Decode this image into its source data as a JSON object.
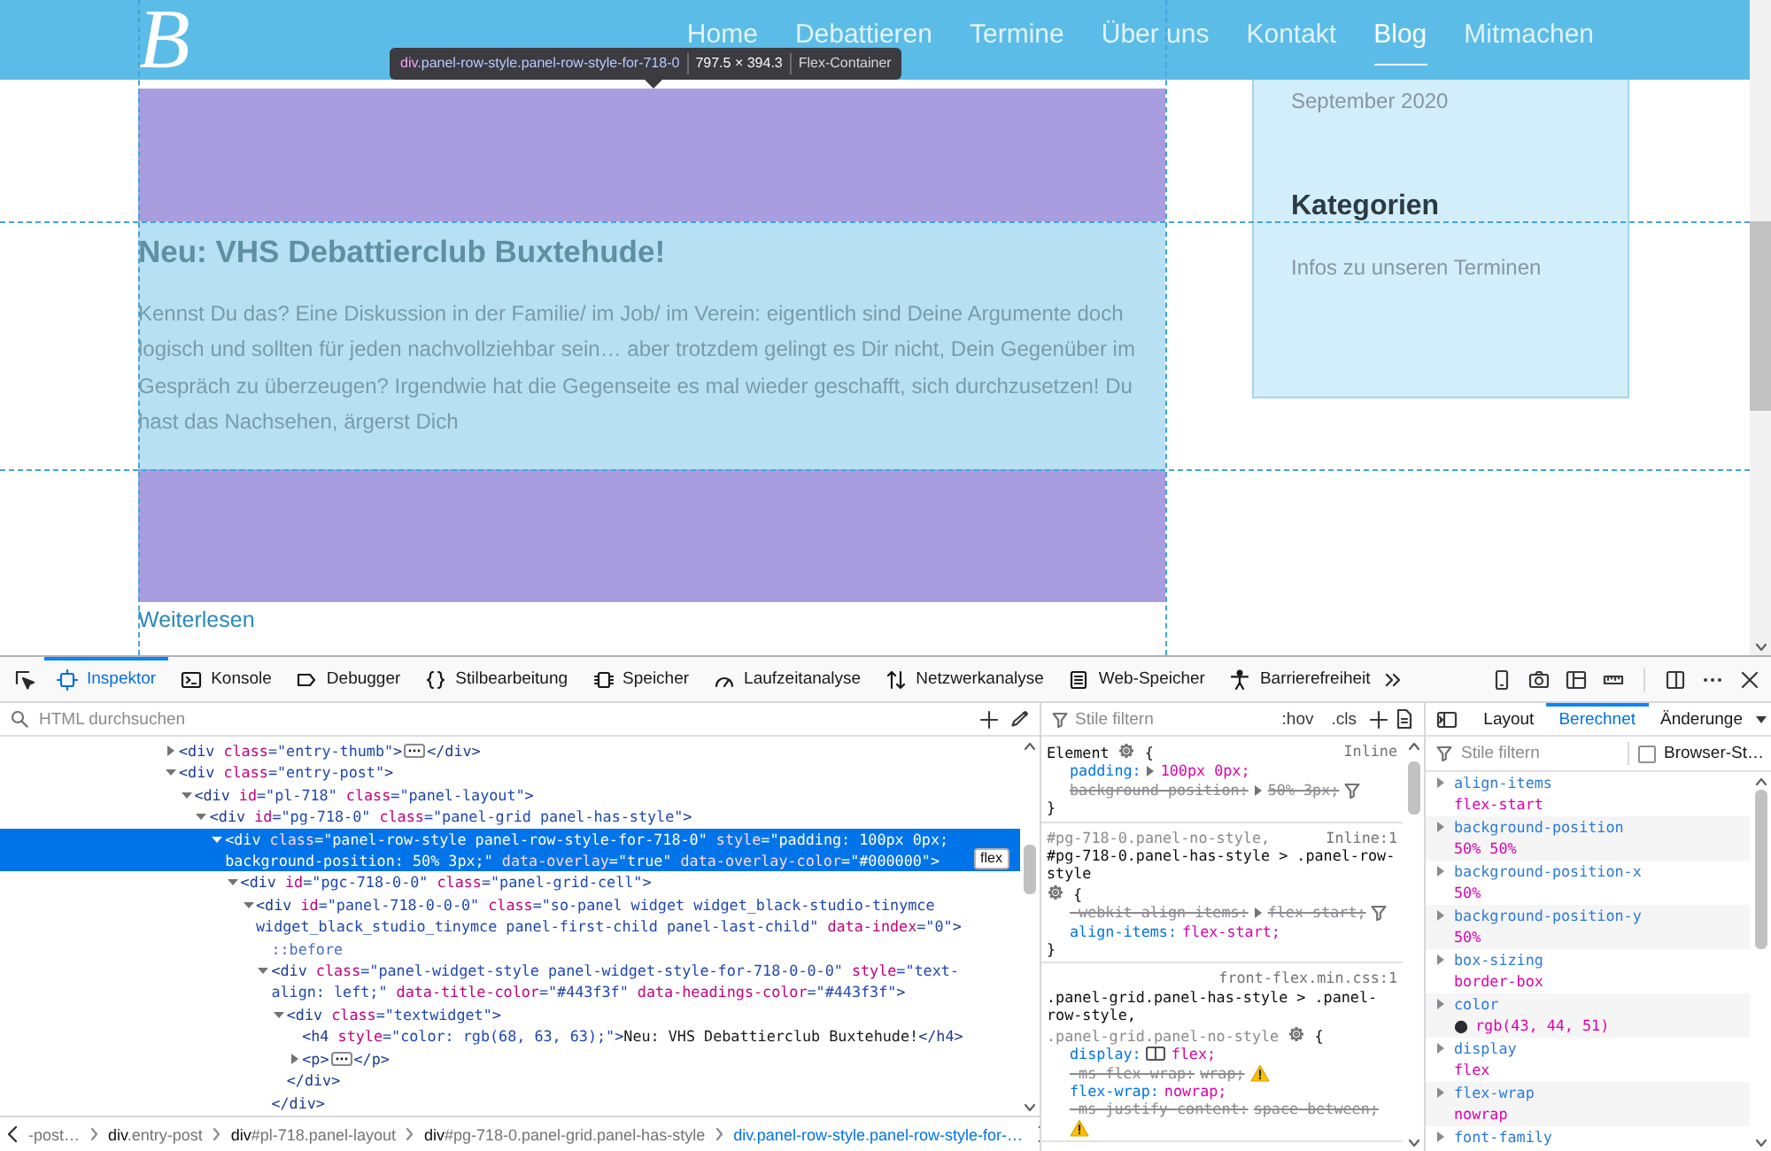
{
  "page": {
    "logo": "B",
    "nav": [
      {
        "label": "Home",
        "selected": false
      },
      {
        "label": "Debattieren",
        "selected": false
      },
      {
        "label": "Termine",
        "selected": false
      },
      {
        "label": "Über uns",
        "selected": false
      },
      {
        "label": "Kontakt",
        "selected": false
      },
      {
        "label": "Blog",
        "selected": true
      },
      {
        "label": "Mitmachen",
        "selected": false
      }
    ],
    "post": {
      "title": "Neu: VHS Debattierclub Buxtehude!",
      "excerpt": "Kennst Du das? Eine Diskussion in der Familie/ im Job/ im Verein: eigentlich sind Deine Argumente doch logisch und sollten für jeden nachvollziehbar sein… aber trotzdem gelingt es Dir nicht, Dein Gegenüber im Gespräch zu überzeugen? Irgendwie hat die Gegenseite es mal wieder geschafft, sich durchzusetzen! Du hast das Nachsehen, ärgerst Dich",
      "link": "Weiterlesen"
    },
    "sidebar": {
      "archive": [
        "September 2020"
      ],
      "categories_title": "Kategorien",
      "categories": [
        "Infos zu unseren Terminen"
      ]
    },
    "highlighter": {
      "tag": "div",
      "classes": ".panel-row-style.panel-row-style-for-718-0",
      "size": "797.5 × 394.3",
      "layout": "Flex-Container"
    }
  },
  "devtools": {
    "tabs": [
      {
        "label": "Inspektor",
        "selected": true
      },
      {
        "label": "Konsole",
        "selected": false
      },
      {
        "label": "Debugger",
        "selected": false
      },
      {
        "label": "Stilbearbeitung",
        "selected": false
      },
      {
        "label": "Speicher",
        "selected": false
      },
      {
        "label": "Laufzeitanalyse",
        "selected": false
      },
      {
        "label": "Netzwerkanalyse",
        "selected": false
      },
      {
        "label": "Web-Speicher",
        "selected": false
      },
      {
        "label": "Barrierefreiheit",
        "selected": false
      }
    ],
    "markup": {
      "search_placeholder": "HTML durchsuchen",
      "nodes": [
        {
          "open": [
            {
              "kind": "tag",
              "text": "<div"
            },
            {
              "kind": "attr",
              "text": " class"
            },
            {
              "kind": "value",
              "text": "=\"entry-thumb\""
            },
            {
              "kind": "tag",
              "text": ">"
            }
          ],
          "expanded": false,
          "selected": false,
          "close": [
            {
              "kind": "tag",
              "text": "</div>"
            }
          ]
        },
        {
          "open": [
            {
              "kind": "tag",
              "text": "<div"
            },
            {
              "kind": "attr",
              "text": " class"
            },
            {
              "kind": "value",
              "text": "=\"entry-post\""
            },
            {
              "kind": "tag",
              "text": ">"
            }
          ],
          "expanded": true,
          "selected": false,
          "children": [
            {
              "open": [
                {
                  "kind": "tag",
                  "text": "<div"
                },
                {
                  "kind": "attr",
                  "text": " id"
                },
                {
                  "kind": "value",
                  "text": "=\"pl-718\""
                },
                {
                  "kind": "attr",
                  "text": " class"
                },
                {
                  "kind": "value",
                  "text": "=\"panel-layout\""
                },
                {
                  "kind": "tag",
                  "text": ">"
                }
              ],
              "expanded": true,
              "selected": false,
              "children": [
                {
                  "open": [
                    {
                      "kind": "tag",
                      "text": "<div"
                    },
                    {
                      "kind": "attr",
                      "text": " id"
                    },
                    {
                      "kind": "value",
                      "text": "=\"pg-718-0\""
                    },
                    {
                      "kind": "attr",
                      "text": " class"
                    },
                    {
                      "kind": "value",
                      "text": "=\"panel-grid panel-has-style\""
                    },
                    {
                      "kind": "tag",
                      "text": ">"
                    }
                  ],
                  "expanded": true,
                  "selected": false,
                  "children": [
                    {
                      "open": [
                        {
                          "kind": "tag",
                          "text": "<div"
                        },
                        {
                          "kind": "attr",
                          "text": " class"
                        },
                        {
                          "kind": "value",
                          "text": "=\"panel-row-style panel-row-style-for-718-0\""
                        },
                        {
                          "kind": "attr",
                          "text": " style"
                        },
                        {
                          "kind": "value",
                          "text": "=\"padding: 100px 0px; background-position: 50% 3px;\""
                        },
                        {
                          "kind": "attr",
                          "text": " data-overlay"
                        },
                        {
                          "kind": "value",
                          "text": "=\"true\""
                        },
                        {
                          "kind": "attr",
                          "text": " data-overlay-color"
                        },
                        {
                          "kind": "value",
                          "text": "=\"#000000\""
                        },
                        {
                          "kind": "tag",
                          "text": ">"
                        }
                      ],
                      "expanded": true,
                      "selected": true,
                      "badge": "flex",
                      "children": [
                        {
                          "open": [
                            {
                              "kind": "tag",
                              "text": "<div"
                            },
                            {
                              "kind": "attr",
                              "text": " id"
                            },
                            {
                              "kind": "value",
                              "text": "=\"pgc-718-0-0\""
                            },
                            {
                              "kind": "attr",
                              "text": " class"
                            },
                            {
                              "kind": "value",
                              "text": "=\"panel-grid-cell\""
                            },
                            {
                              "kind": "tag",
                              "text": ">"
                            }
                          ],
                          "expanded": true,
                          "selected": false,
                          "children": [
                            {
                              "open": [
                                {
                                  "kind": "tag",
                                  "text": "<div"
                                },
                                {
                                  "kind": "attr",
                                  "text": " id"
                                },
                                {
                                  "kind": "value",
                                  "text": "=\"panel-718-0-0-0\""
                                },
                                {
                                  "kind": "attr",
                                  "text": " class"
                                },
                                {
                                  "kind": "value",
                                  "text": "=\"so-panel widget widget_black-studio-tinymce widget_black_studio_tinymce panel-first-child panel-last-child\""
                                },
                                {
                                  "kind": "attr",
                                  "text": " data-index"
                                },
                                {
                                  "kind": "value",
                                  "text": "=\"0\""
                                },
                                {
                                  "kind": "tag",
                                  "text": ">"
                                }
                              ],
                              "expanded": true,
                              "selected": false,
                              "children": [
                                {
                                  "open": [
                                    {
                                      "kind": "pseudo",
                                      "text": "::before"
                                    }
                                  ],
                                  "selected": false
                                },
                                {
                                  "open": [
                                    {
                                      "kind": "tag",
                                      "text": "<div"
                                    },
                                    {
                                      "kind": "attr",
                                      "text": " class"
                                    },
                                    {
                                      "kind": "value",
                                      "text": "=\"panel-widget-style panel-widget-style-for-718-0-0-0\""
                                    },
                                    {
                                      "kind": "attr",
                                      "text": " style"
                                    },
                                    {
                                      "kind": "value",
                                      "text": "=\"text-align: left;\""
                                    },
                                    {
                                      "kind": "attr",
                                      "text": " data-title-color"
                                    },
                                    {
                                      "kind": "value",
                                      "text": "=\"#443f3f\""
                                    },
                                    {
                                      "kind": "attr",
                                      "text": " data-headings-color"
                                    },
                                    {
                                      "kind": "value",
                                      "text": "=\"#443f3f\""
                                    },
                                    {
                                      "kind": "tag",
                                      "text": ">"
                                    }
                                  ],
                                  "expanded": true,
                                  "selected": false,
                                  "close": [
                                    {
                                      "kind": "tag",
                                      "text": "</div>"
                                    }
                                  ],
                                  "children": [
                                    {
                                      "open": [
                                        {
                                          "kind": "tag",
                                          "text": "<div"
                                        },
                                        {
                                          "kind": "attr",
                                          "text": " class"
                                        },
                                        {
                                          "kind": "value",
                                          "text": "=\"textwidget\""
                                        },
                                        {
                                          "kind": "tag",
                                          "text": ">"
                                        }
                                      ],
                                      "expanded": true,
                                      "selected": false,
                                      "close": [
                                        {
                                          "kind": "tag",
                                          "text": "</div>"
                                        }
                                      ],
                                      "children": [
                                        {
                                          "open": [
                                            {
                                              "kind": "tag",
                                              "text": "<h4"
                                            },
                                            {
                                              "kind": "attr",
                                              "text": " style"
                                            },
                                            {
                                              "kind": "value",
                                              "text": "=\"color: rgb(68, 63, 63);\""
                                            },
                                            {
                                              "kind": "tag",
                                              "text": ">"
                                            },
                                            {
                                              "kind": "text",
                                              "text": "Neu: VHS Debattierclub Buxtehude!"
                                            },
                                            {
                                              "kind": "tag",
                                              "text": "</h4>"
                                            }
                                          ],
                                          "selected": false
                                        },
                                        {
                                          "open": [
                                            {
                                              "kind": "tag",
                                              "text": "<p"
                                            },
                                            {
                                              "kind": "tag",
                                              "text": ">"
                                            }
                                          ],
                                          "expanded": false,
                                          "selected": false,
                                          "close": [
                                            {
                                              "kind": "tag",
                                              "text": "</p>"
                                            }
                                          ]
                                        }
                                      ]
                                    }
                                  ]
                                }
                              ]
                            }
                          ]
                        }
                      ]
                    }
                  ]
                }
              ]
            }
          ]
        }
      ],
      "breadcrumbs": [
        {
          "detail": "-post…",
          "selected": false
        },
        {
          "tag": "div",
          "detail": ".entry-post",
          "selected": false
        },
        {
          "tag": "div",
          "detail": "#pl-718.panel-layout",
          "selected": false
        },
        {
          "tag": "div",
          "detail": "#pg-718-0.panel-grid.panel-has-style",
          "selected": false
        },
        {
          "tag": "div",
          "detail": ".panel-row-style.panel-row-style-for-…",
          "selected": true
        }
      ]
    },
    "rules": {
      "filter_placeholder": "Stile filtern",
      "hover_toggle": ":hov",
      "class_toggle": ".cls",
      "rules": [
        {
          "selector": [
            {
              "text": "Element",
              "matched": true
            }
          ],
          "source": "Inline",
          "open": "{",
          "close": "}",
          "declarations": [
            {
              "property": "padding:",
              "value": "100px 0px;",
              "overridden": false,
              "expandable": true,
              "filter": false,
              "warning": false,
              "layout_toggle": false
            },
            {
              "property": "background-position:",
              "value": "50% 3px;",
              "overridden": true,
              "expandable": true,
              "filter": true,
              "warning": false,
              "layout_toggle": false
            }
          ]
        },
        {
          "selector": [
            {
              "text": "#pg-718-0.panel-no-style,",
              "matched": false
            },
            {
              "text": "#pg-718-0.panel-has-style > .panel-row-style",
              "matched": true
            }
          ],
          "source": "Inline:1",
          "open": "{",
          "close": "}",
          "declarations": [
            {
              "property": "-webkit-align-items:",
              "value": "flex-start;",
              "overridden": true,
              "expandable": true,
              "filter": true,
              "warning": false,
              "layout_toggle": false
            },
            {
              "property": "align-items:",
              "value": "flex-start;",
              "overridden": false,
              "expandable": false,
              "filter": false,
              "warning": false,
              "layout_toggle": false
            }
          ]
        },
        {
          "selector": [
            {
              "text": ".panel-grid.panel-has-style > .panel-row-style,",
              "matched": true
            },
            {
              "text": ".panel-grid.panel-no-style",
              "matched": false
            }
          ],
          "source": "front-flex.min.css:1",
          "open": "{",
          "declarations": [
            {
              "property": "display:",
              "value": "flex;",
              "overridden": false,
              "expandable": false,
              "filter": false,
              "warning": false,
              "layout_toggle": true
            },
            {
              "property": "-ms-flex-wrap:",
              "value": "wrap;",
              "overridden": true,
              "expandable": false,
              "filter": false,
              "warning": true,
              "layout_toggle": false
            },
            {
              "property": "flex-wrap:",
              "value": "nowrap;",
              "overridden": false,
              "expandable": false,
              "filter": false,
              "warning": false,
              "layout_toggle": false
            },
            {
              "property": "-ms-justify-content:",
              "value": "space-between;",
              "overridden": true,
              "expandable": false,
              "filter": false,
              "warning": true,
              "layout_toggle": false
            }
          ]
        }
      ]
    },
    "sidebar_tabs": [
      {
        "label": "Layout",
        "selected": false
      },
      {
        "label": "Berechnet",
        "selected": true
      },
      {
        "label": "Änderunge",
        "selected": false
      }
    ],
    "computed": {
      "filter_placeholder": "Stile filtern",
      "browser_styles": {
        "label": "Browser-St…",
        "checked": false
      },
      "properties": [
        {
          "name": "align-items",
          "value": "flex-start"
        },
        {
          "name": "background-position",
          "value": "50% 50%"
        },
        {
          "name": "background-position-x",
          "value": "50%"
        },
        {
          "name": "background-position-y",
          "value": "50%"
        },
        {
          "name": "box-sizing",
          "value": "border-box"
        },
        {
          "name": "color",
          "value": "rgb(43, 44, 51)",
          "color": "#2b2c33"
        },
        {
          "name": "display",
          "value": "flex"
        },
        {
          "name": "flex-wrap",
          "value": "nowrap"
        },
        {
          "name": "font-family"
        }
      ]
    }
  }
}
